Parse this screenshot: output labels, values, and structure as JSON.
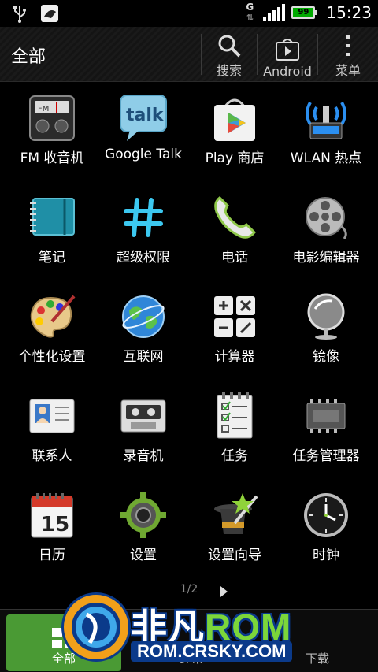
{
  "status_bar": {
    "network_type": "G",
    "battery_level": "99",
    "time": "15:23",
    "icons": [
      "usb-icon",
      "notification-app-icon",
      "data-network-icon",
      "signal-icon",
      "battery-icon"
    ]
  },
  "action_bar": {
    "title": "全部",
    "actions": [
      {
        "label": "搜索",
        "icon": "search-icon"
      },
      {
        "label": "Android",
        "icon": "android-market-icon"
      },
      {
        "label": "菜单",
        "icon": "overflow-menu-icon"
      }
    ]
  },
  "apps": [
    {
      "label": "FM 收音机",
      "icon": "fm-radio-icon"
    },
    {
      "label": "Google Talk",
      "icon": "google-talk-icon"
    },
    {
      "label": "Play 商店",
      "icon": "play-store-icon"
    },
    {
      "label": "WLAN 热点",
      "icon": "wlan-hotspot-icon"
    },
    {
      "label": "笔记",
      "icon": "notebook-icon"
    },
    {
      "label": "超级权限",
      "icon": "superuser-icon"
    },
    {
      "label": "电话",
      "icon": "phone-icon"
    },
    {
      "label": "电影编辑器",
      "icon": "movie-editor-icon"
    },
    {
      "label": "个性化设置",
      "icon": "personalize-icon"
    },
    {
      "label": "互联网",
      "icon": "internet-globe-icon"
    },
    {
      "label": "计算器",
      "icon": "calculator-icon"
    },
    {
      "label": "镜像",
      "icon": "mirror-icon"
    },
    {
      "label": "联系人",
      "icon": "contacts-icon"
    },
    {
      "label": "录音机",
      "icon": "voice-recorder-icon"
    },
    {
      "label": "任务",
      "icon": "tasks-icon"
    },
    {
      "label": "任务管理器",
      "icon": "task-manager-icon"
    },
    {
      "label": "日历",
      "icon": "calendar-icon",
      "day": "15"
    },
    {
      "label": "设置",
      "icon": "settings-gear-icon"
    },
    {
      "label": "设置向导",
      "icon": "setup-wizard-icon"
    },
    {
      "label": "时钟",
      "icon": "clock-icon"
    }
  ],
  "pager": {
    "text": "1/2"
  },
  "tabs": [
    {
      "label": "全部",
      "active": true
    },
    {
      "label": "经常",
      "active": false
    },
    {
      "label": "下载",
      "active": false
    }
  ],
  "watermark": {
    "brand_cn": "非凡",
    "brand_rom": "ROM",
    "url": "ROM.CRSKY.COM"
  },
  "colors": {
    "background": "#000000",
    "active_tab": "#4a9a34",
    "watermark_blue": "#0b3a8a",
    "watermark_green": "#7cd63a"
  }
}
